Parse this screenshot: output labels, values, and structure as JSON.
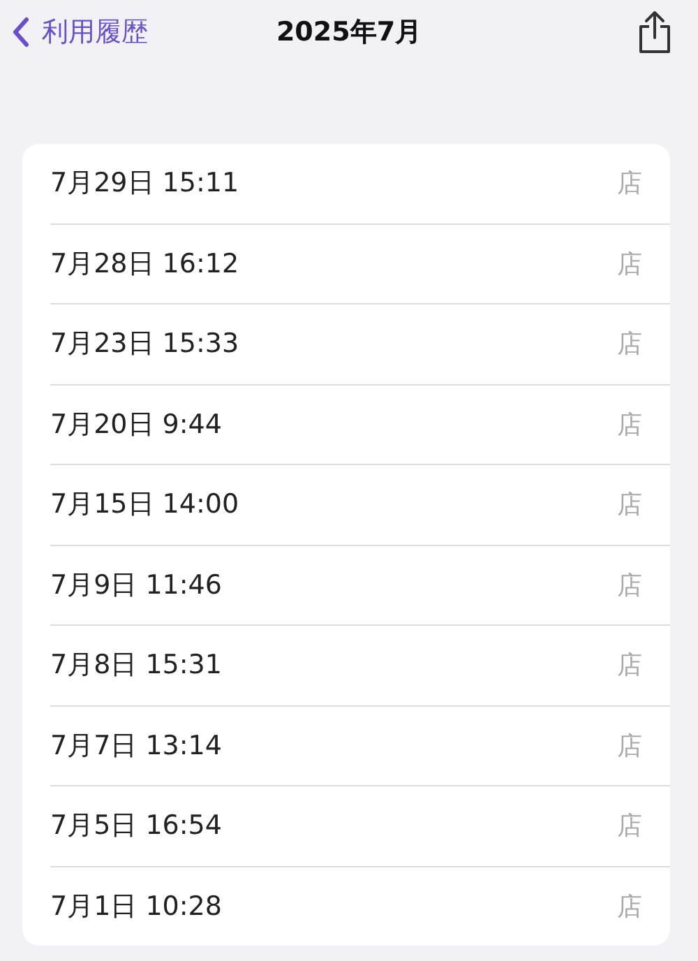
{
  "nav": {
    "back": "利用履歴",
    "title": "2025年7月"
  },
  "rows": [
    {
      "date": "7月29日 15:11",
      "store": "店"
    },
    {
      "date": "7月28日 16:12",
      "store": "店"
    },
    {
      "date": "7月23日 15:33",
      "store": "店"
    },
    {
      "date": "7月20日 9:44",
      "store": "店"
    },
    {
      "date": "7月15日 14:00",
      "store": "店"
    },
    {
      "date": "7月9日 11:46",
      "store": "店"
    },
    {
      "date": "7月8日 15:31",
      "store": "店"
    },
    {
      "date": "7月7日 13:14",
      "store": "店"
    },
    {
      "date": "7月5日 16:54",
      "store": "店"
    },
    {
      "date": "7月1日 10:28",
      "store": "店"
    }
  ]
}
